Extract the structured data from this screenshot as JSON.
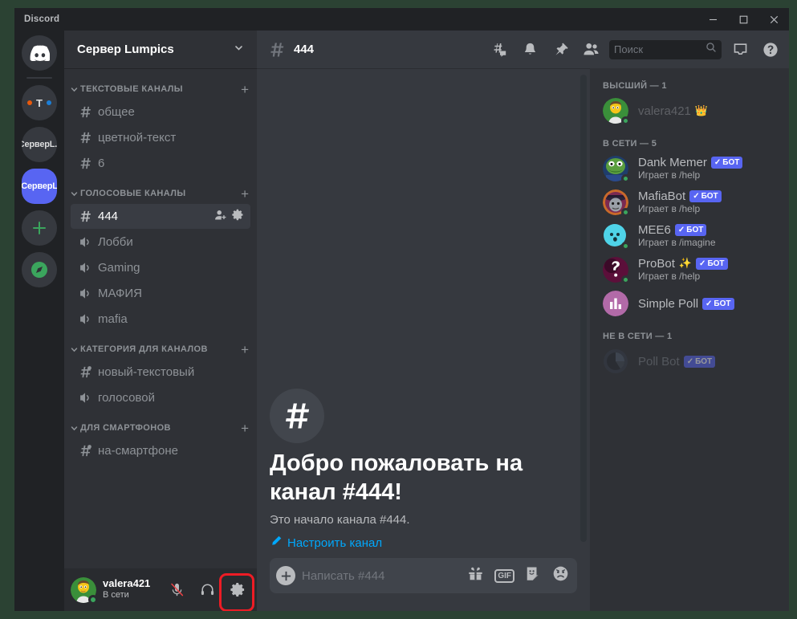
{
  "window": {
    "app_title": "Discord",
    "minimize_label": "minimize",
    "maximize_label": "maximize",
    "close_label": "close"
  },
  "guild_rail": {
    "home_label": "discord-home",
    "items": [
      {
        "label": "T",
        "type": "dots"
      },
      {
        "label": "СерверL.r",
        "type": "text"
      },
      {
        "label": "СерверL",
        "type": "text",
        "active": true
      }
    ],
    "add_label": "+",
    "explore_label": "explore"
  },
  "server": {
    "name": "Сервер Lumpics",
    "categories": [
      {
        "name": "ТЕКСТОВЫЕ КАНАЛЫ",
        "channels": [
          {
            "name": "общее",
            "icon": "hash"
          },
          {
            "name": "цветной-текст",
            "icon": "hash"
          },
          {
            "name": "6",
            "icon": "hash"
          }
        ]
      },
      {
        "name": "ГОЛОСОВЫЕ КАНАЛЫ",
        "channels": [
          {
            "name": "444",
            "icon": "hash",
            "active": true
          },
          {
            "name": "Лобби",
            "icon": "speaker"
          },
          {
            "name": "Gaming",
            "icon": "speaker"
          },
          {
            "name": "МАФИЯ",
            "icon": "speaker"
          },
          {
            "name": "mafia",
            "icon": "speaker"
          }
        ]
      },
      {
        "name": "КАТЕГОРИЯ ДЛЯ КАНАЛОВ",
        "channels": [
          {
            "name": "новый-текстовый",
            "icon": "hash-lock"
          },
          {
            "name": "голосовой",
            "icon": "speaker"
          }
        ]
      },
      {
        "name": "ДЛЯ СМАРТФОНОВ",
        "channels": [
          {
            "name": "на-смартфоне",
            "icon": "hash-lock"
          }
        ]
      }
    ]
  },
  "user_panel": {
    "name": "valera421",
    "status": "В сети",
    "mute_label": "microphone-muted",
    "deafen_label": "headphones",
    "settings_label": "user-settings",
    "highlight_color": "#ee1c25"
  },
  "chat_header": {
    "channel_name": "444",
    "threads_label": "threads",
    "notifications_label": "notifications",
    "pinned_label": "pinned-messages",
    "members_label": "member-list",
    "inbox_label": "inbox",
    "help_label": "help"
  },
  "search": {
    "placeholder": "Поиск",
    "value": ""
  },
  "welcome": {
    "title": "Добро пожаловать на канал #444!",
    "subtitle": "Это начало канала #444.",
    "link": "Настроить канал"
  },
  "composer": {
    "placeholder": "Написать #444",
    "value": "",
    "gift_label": "gift",
    "gif_label": "GIF",
    "sticker_label": "sticker",
    "emoji_label": "emoji"
  },
  "members": {
    "groups": [
      {
        "title": "ВЫСШИЙ — 1",
        "people": [
          {
            "name": "valera421",
            "badge": "",
            "activity": "",
            "crown": "👑",
            "avatar": "homer",
            "online": true,
            "dim": true
          }
        ]
      },
      {
        "title": "В СЕТИ — 5",
        "people": [
          {
            "name": "Dank Memer",
            "badge": "БОТ",
            "activity": "Играет в /help",
            "avatar": "pepe",
            "online": true
          },
          {
            "name": "MafiaBot",
            "badge": "БОТ",
            "activity": "Играет в /help",
            "avatar": "mafia",
            "online": true
          },
          {
            "name": "MEE6",
            "badge": "БОТ",
            "activity": "Играет в /imagine",
            "avatar": "mee6",
            "online": true
          },
          {
            "name": "ProBot",
            "badge": "БОТ",
            "activity": "Играет в /help",
            "avatar": "probot",
            "online": true,
            "sparkle": "✨"
          },
          {
            "name": "Simple Poll",
            "badge": "БОТ",
            "activity": "",
            "avatar": "poll",
            "online": false
          }
        ]
      },
      {
        "title": "НЕ В СЕТИ — 1",
        "people": [
          {
            "name": "Poll Bot",
            "badge": "БОТ",
            "activity": "",
            "avatar": "pollbot",
            "online": false,
            "offline": true
          }
        ]
      }
    ]
  }
}
